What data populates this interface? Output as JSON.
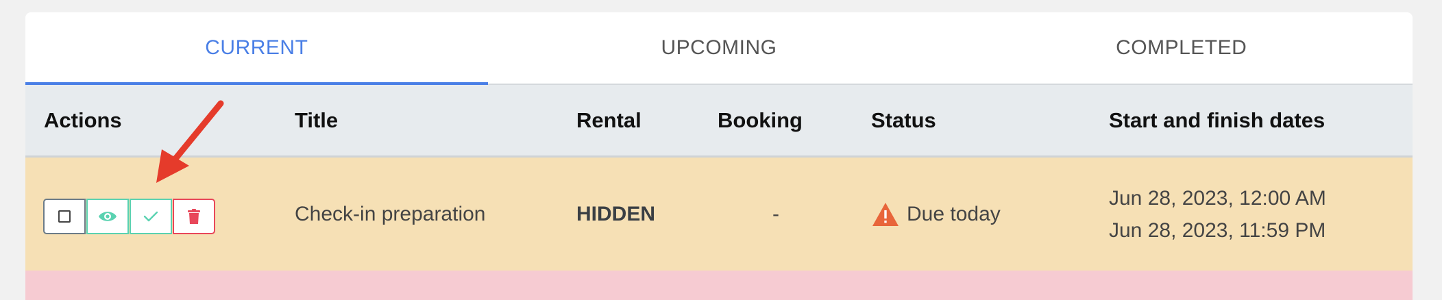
{
  "tabs": [
    {
      "label": "CURRENT",
      "active": true
    },
    {
      "label": "UPCOMING",
      "active": false
    },
    {
      "label": "COMPLETED",
      "active": false
    }
  ],
  "table": {
    "headers": {
      "actions": "Actions",
      "title": "Title",
      "rental": "Rental",
      "booking": "Booking",
      "status": "Status",
      "dates": "Start and finish dates"
    },
    "rows": [
      {
        "title": "Check-in preparation",
        "rental": "HIDDEN",
        "booking": "-",
        "status": "Due today",
        "start": "Jun 28, 2023, 12:00 AM",
        "finish": "Jun 28, 2023, 11:59 PM",
        "actions": [
          "checkbox-icon",
          "eye-icon",
          "check-icon",
          "trash-icon"
        ]
      }
    ]
  },
  "colors": {
    "accent": "#4a7fe6",
    "row_due_today": "#f6e0b5",
    "row_overdue": "#f6cbd2",
    "warning": "#e8653a",
    "view_complete": "#5ad2b1",
    "delete": "#e8475a",
    "annotation_arrow": "#e53b2b"
  }
}
